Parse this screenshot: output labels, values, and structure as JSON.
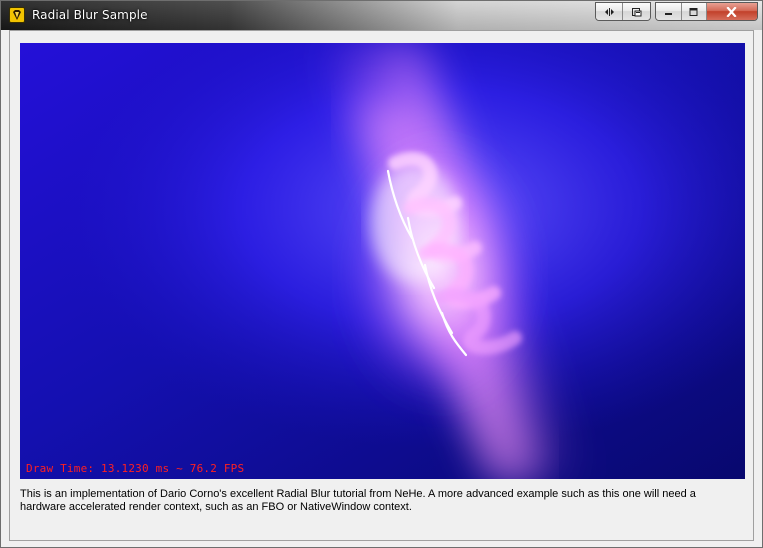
{
  "window": {
    "title": "Radial Blur Sample",
    "icon": "app-gem-icon"
  },
  "title_buttons": {
    "extra": [
      "resize-arrows-icon",
      "layout-icon"
    ],
    "caption": [
      "minimize-icon",
      "maximize-icon",
      "close-icon"
    ]
  },
  "render": {
    "fps_text": "Draw Time: 13.1230 ms ~ 76.2 FPS",
    "colors": {
      "background": "#0a0a7a",
      "blue": "#2a1cff",
      "glow": "#ff9cff",
      "overlay_text": "#ff2020"
    }
  },
  "description": "This is an implementation of Dario Corno's excellent Radial Blur tutorial from NeHe. A more advanced example such as this one will need a hardware accelerated render context, such as an FBO or NativeWindow context."
}
